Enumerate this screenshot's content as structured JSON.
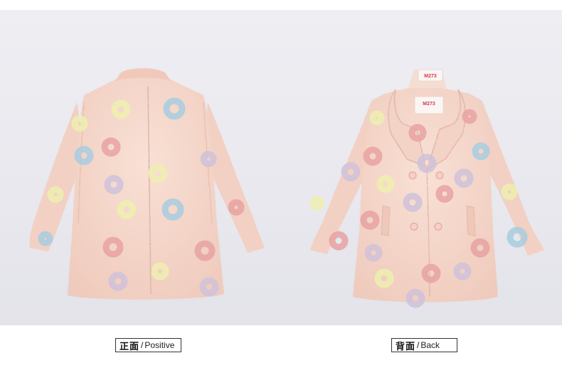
{
  "captions": {
    "front": {
      "cn": "正面",
      "sep": "/",
      "en": "Positive"
    },
    "back": {
      "cn": "背面",
      "sep": "/",
      "en": "Back"
    }
  },
  "label_tag": {
    "brand": "M273"
  },
  "colors": {
    "backdrop": "#e8e8ee",
    "coat": "#f6d9cd",
    "coat_shadow": "#e9c4b6",
    "donut_blue": "#a8cde0",
    "donut_pink": "#e8a3a3",
    "donut_yellow": "#eef0b0",
    "donut_lilac": "#cfc2da",
    "caption_border": "#333333"
  }
}
